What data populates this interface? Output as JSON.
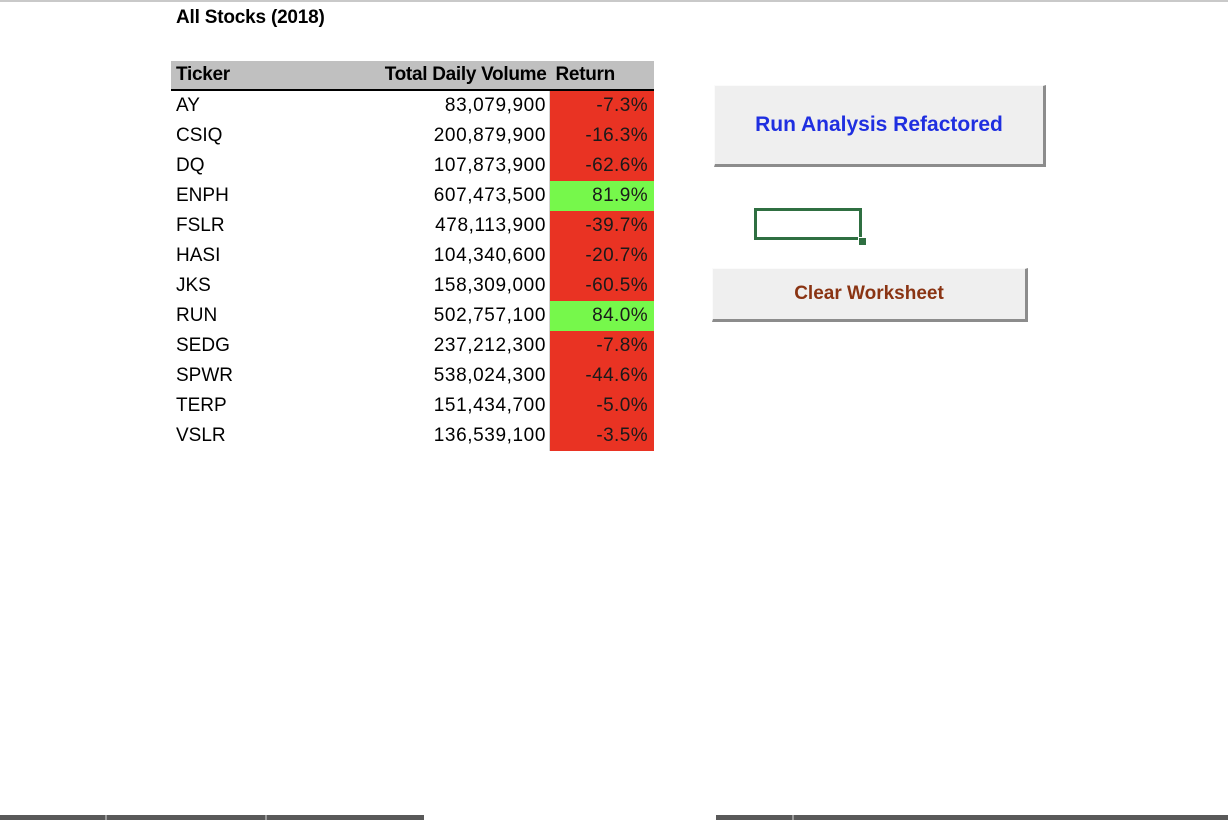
{
  "sheet": {
    "title": "All Stocks (2018)"
  },
  "table": {
    "headers": {
      "ticker": "Ticker",
      "volume": "Total Daily Volume",
      "return": "Return"
    },
    "rows": [
      {
        "ticker": "AY",
        "volume": "83,079,900",
        "return": "-7.3%",
        "status": "negative"
      },
      {
        "ticker": "CSIQ",
        "volume": "200,879,900",
        "return": "-16.3%",
        "status": "negative"
      },
      {
        "ticker": "DQ",
        "volume": "107,873,900",
        "return": "-62.6%",
        "status": "negative"
      },
      {
        "ticker": "ENPH",
        "volume": "607,473,500",
        "return": "81.9%",
        "status": "positive"
      },
      {
        "ticker": "FSLR",
        "volume": "478,113,900",
        "return": "-39.7%",
        "status": "negative"
      },
      {
        "ticker": "HASI",
        "volume": "104,340,600",
        "return": "-20.7%",
        "status": "negative"
      },
      {
        "ticker": "JKS",
        "volume": "158,309,000",
        "return": "-60.5%",
        "status": "negative"
      },
      {
        "ticker": "RUN",
        "volume": "502,757,100",
        "return": "84.0%",
        "status": "positive"
      },
      {
        "ticker": "SEDG",
        "volume": "237,212,300",
        "return": "-7.8%",
        "status": "negative"
      },
      {
        "ticker": "SPWR",
        "volume": "538,024,300",
        "return": "-44.6%",
        "status": "negative"
      },
      {
        "ticker": "TERP",
        "volume": "151,434,700",
        "return": "-5.0%",
        "status": "negative"
      },
      {
        "ticker": "VSLR",
        "volume": "136,539,100",
        "return": "-3.5%",
        "status": "negative"
      }
    ]
  },
  "buttons": {
    "run_label": "Run Analysis Refactored",
    "clear_label": "Clear Worksheet"
  },
  "colors": {
    "positive": "#76f84b",
    "negative": "#e93323",
    "run_text": "#1f2fe0",
    "clear_text": "#8a3413",
    "header_bg": "#c0c0c0",
    "selection": "#2f6f41"
  }
}
